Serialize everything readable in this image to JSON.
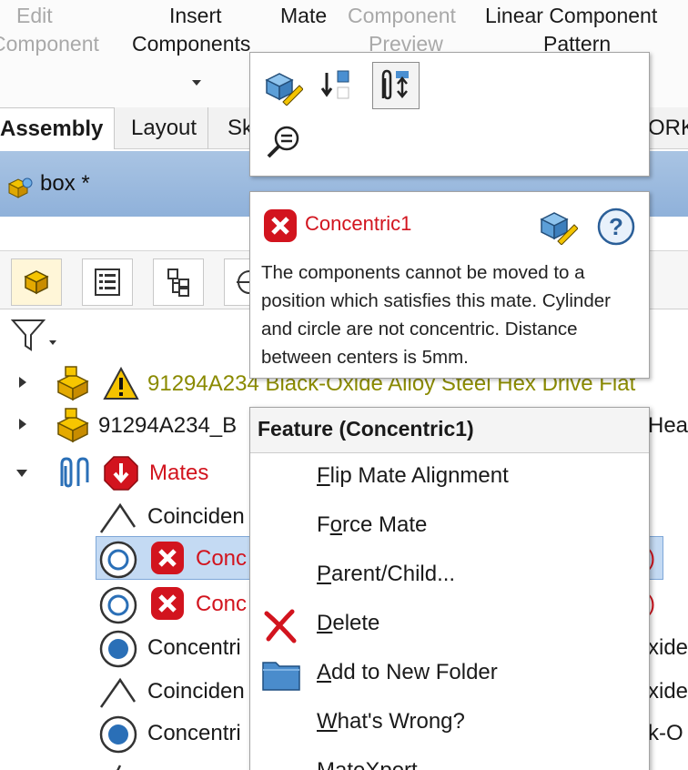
{
  "ribbon": {
    "edit_line1": "Edit",
    "edit_line2": "Component",
    "insert_line1": "Insert",
    "insert_line2": "Components",
    "mate": "Mate",
    "preview_line1": "Component",
    "preview_line2": "Preview",
    "pattern_line1": "Linear Component",
    "pattern_line2": "Pattern"
  },
  "tabs": [
    {
      "label": "Assembly"
    },
    {
      "label": "Layout"
    },
    {
      "label": "Sk"
    },
    {
      "label": "ORK"
    }
  ],
  "window": {
    "title": "box *"
  },
  "tree": {
    "row1": "91294A234 Black-Oxide Alloy Steel Hex Drive Flat",
    "row2_left": "91294A234_B",
    "row2_right": "Hea",
    "mates": "Mates",
    "items": [
      {
        "left": "Coinciden",
        "right": ""
      },
      {
        "left": "Conc",
        "right": ")"
      },
      {
        "left": "Conc",
        "right": ")"
      },
      {
        "left": "Concentri",
        "right": "xide"
      },
      {
        "left": "Coinciden",
        "right": "xide"
      },
      {
        "left": "Concentri",
        "right": "k-O"
      },
      {
        "left": "",
        "right": ""
      }
    ]
  },
  "tooltip": {
    "name": "Concentric1",
    "message": "The components cannot be moved to a position which satisfies this mate. Cylinder and circle are not concentric. Distance between centers is 5mm."
  },
  "menu": {
    "header": "Feature (Concentric1)",
    "items": [
      {
        "pre": "",
        "key": "F",
        "post": "lip Mate Alignment"
      },
      {
        "pre": "F",
        "key": "o",
        "post": "rce Mate"
      },
      {
        "pre": "",
        "key": "P",
        "post": "arent/Child..."
      },
      {
        "pre": "",
        "key": "D",
        "post": "elete"
      },
      {
        "pre": "",
        "key": "A",
        "post": "dd to New Folder"
      },
      {
        "pre": "",
        "key": "W",
        "post": "hat's Wrong?"
      },
      {
        "pre": "MateXpert",
        "key": "",
        "post": ""
      }
    ]
  },
  "colors": {
    "error": "#d2141e",
    "selection": "#c4daf3",
    "titlebar": "#9ab8dd"
  }
}
